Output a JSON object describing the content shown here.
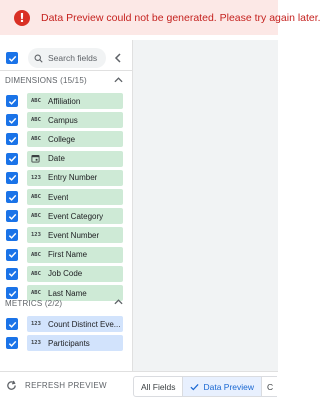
{
  "error": {
    "message": "Data Preview could not be generated. Please try again later.",
    "icon": "error-icon",
    "color": "#d93025",
    "background": "#fce8e6"
  },
  "search": {
    "placeholder": "Search fields"
  },
  "dimensions": {
    "title": "DIMENSIONS (15/15)",
    "fields": [
      {
        "type": "ABC",
        "name": "Affiliation",
        "checked": true
      },
      {
        "type": "ABC",
        "name": "Campus",
        "checked": true
      },
      {
        "type": "ABC",
        "name": "College",
        "checked": true
      },
      {
        "type": "date",
        "name": "Date",
        "checked": true
      },
      {
        "type": "123",
        "name": "Entry Number",
        "checked": true
      },
      {
        "type": "ABC",
        "name": "Event",
        "checked": true
      },
      {
        "type": "ABC",
        "name": "Event Category",
        "checked": true
      },
      {
        "type": "123",
        "name": "Event Number",
        "checked": true
      },
      {
        "type": "ABC",
        "name": "First Name",
        "checked": true
      },
      {
        "type": "ABC",
        "name": "Job Code",
        "checked": true
      },
      {
        "type": "ABC",
        "name": "Last Name",
        "checked": true
      }
    ]
  },
  "metrics": {
    "title": "METRICS (2/2)",
    "fields": [
      {
        "type": "123",
        "name": "Count Distinct Eve...",
        "checked": true
      },
      {
        "type": "123",
        "name": "Participants",
        "checked": true
      }
    ]
  },
  "footer": {
    "refresh_label": "REFRESH PREVIEW",
    "tabs": [
      {
        "label": "All Fields",
        "active": false
      },
      {
        "label": "Data Preview",
        "active": true
      },
      {
        "label": "C",
        "active": false
      }
    ]
  },
  "colors": {
    "accent": "#1a73e8",
    "dimension_chip": "#ceead6",
    "metric_chip": "#d2e3fc"
  }
}
